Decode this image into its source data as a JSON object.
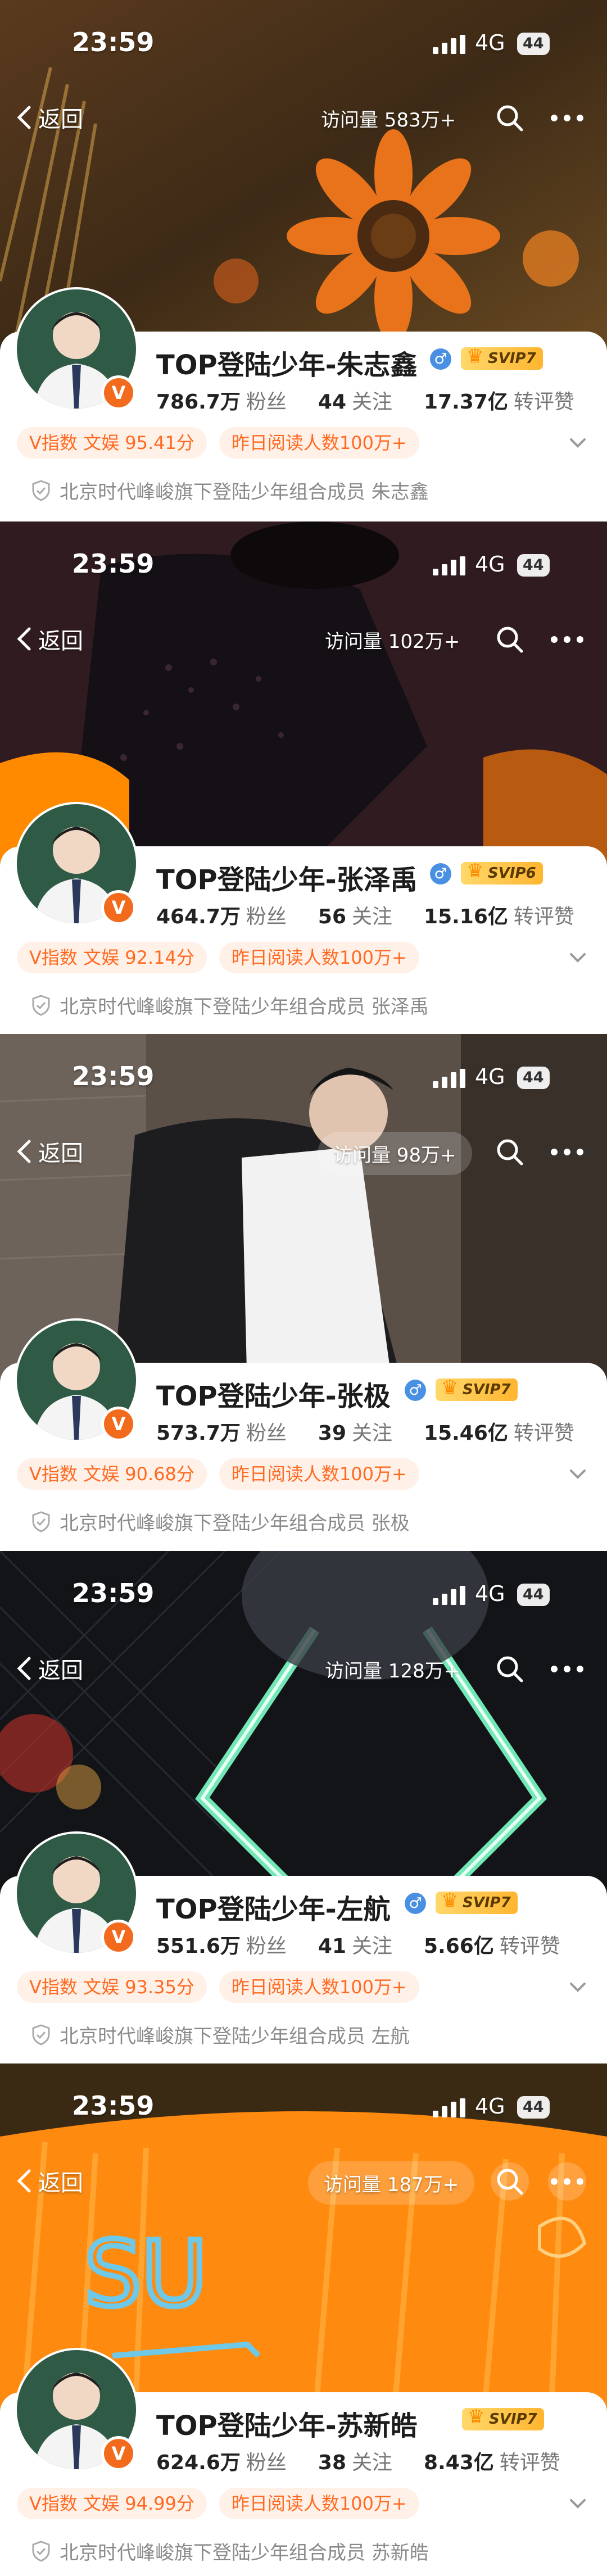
{
  "status_bar": {
    "time": "23:59",
    "network": "4G",
    "battery": "44"
  },
  "nav": {
    "back_label": "返回"
  },
  "profiles": [
    {
      "name": "TOP登陆少年-朱志鑫",
      "gender_icon": "male-icon",
      "svip_badge": "SVIP7",
      "followers": "786.7万",
      "followers_label": "粉丝",
      "following": "44",
      "following_label": "关注",
      "engagement": "17.37亿",
      "engagement_label": "转评赞",
      "visits": "访问量 583万+",
      "v_index": "V指数 文娱 95.41分",
      "reads_tag": "昨日阅读人数100万+",
      "certification": "北京时代峰峻旗下登陆少年组合成员 朱志鑫"
    },
    {
      "name": "TOP登陆少年-张泽禹",
      "gender_icon": "male-icon",
      "svip_badge": "SVIP6",
      "followers": "464.7万",
      "followers_label": "粉丝",
      "following": "56",
      "following_label": "关注",
      "engagement": "15.16亿",
      "engagement_label": "转评赞",
      "visits": "访问量 102万+",
      "v_index": "V指数 文娱 92.14分",
      "reads_tag": "昨日阅读人数100万+",
      "certification": "北京时代峰峻旗下登陆少年组合成员 张泽禹"
    },
    {
      "name": "TOP登陆少年-张极",
      "gender_icon": "male-icon",
      "svip_badge": "SVIP7",
      "followers": "573.7万",
      "followers_label": "粉丝",
      "following": "39",
      "following_label": "关注",
      "engagement": "15.46亿",
      "engagement_label": "转评赞",
      "visits": "访问量 98万+",
      "v_index": "V指数 文娱 90.68分",
      "reads_tag": "昨日阅读人数100万+",
      "certification": "北京时代峰峻旗下登陆少年组合成员 张极"
    },
    {
      "name": "TOP登陆少年-左航",
      "gender_icon": "male-icon",
      "svip_badge": "SVIP7",
      "followers": "551.6万",
      "followers_label": "粉丝",
      "following": "41",
      "following_label": "关注",
      "engagement": "5.66亿",
      "engagement_label": "转评赞",
      "visits": "访问量 128万+",
      "v_index": "V指数 文娱 93.35分",
      "reads_tag": "昨日阅读人数100万+",
      "certification": "北京时代峰峻旗下登陆少年组合成员 左航"
    },
    {
      "name": "TOP登陆少年-苏新皓",
      "gender_icon": "none",
      "svip_badge": "SVIP7",
      "followers": "624.6万",
      "followers_label": "粉丝",
      "following": "38",
      "following_label": "关注",
      "engagement": "8.43亿",
      "engagement_label": "转评赞",
      "visits": "访问量 187万+",
      "v_index": "V指数 文娱 94.99分",
      "reads_tag": "昨日阅读人数100万+",
      "certification": "北京时代峰峻旗下登陆少年组合成员 苏新皓"
    }
  ],
  "colors": {
    "accent_orange": "#ff6a22",
    "tag_bg": "#fff1e8",
    "verified_badge": "#f26a1c",
    "gender_blue": "#4a90e2"
  }
}
